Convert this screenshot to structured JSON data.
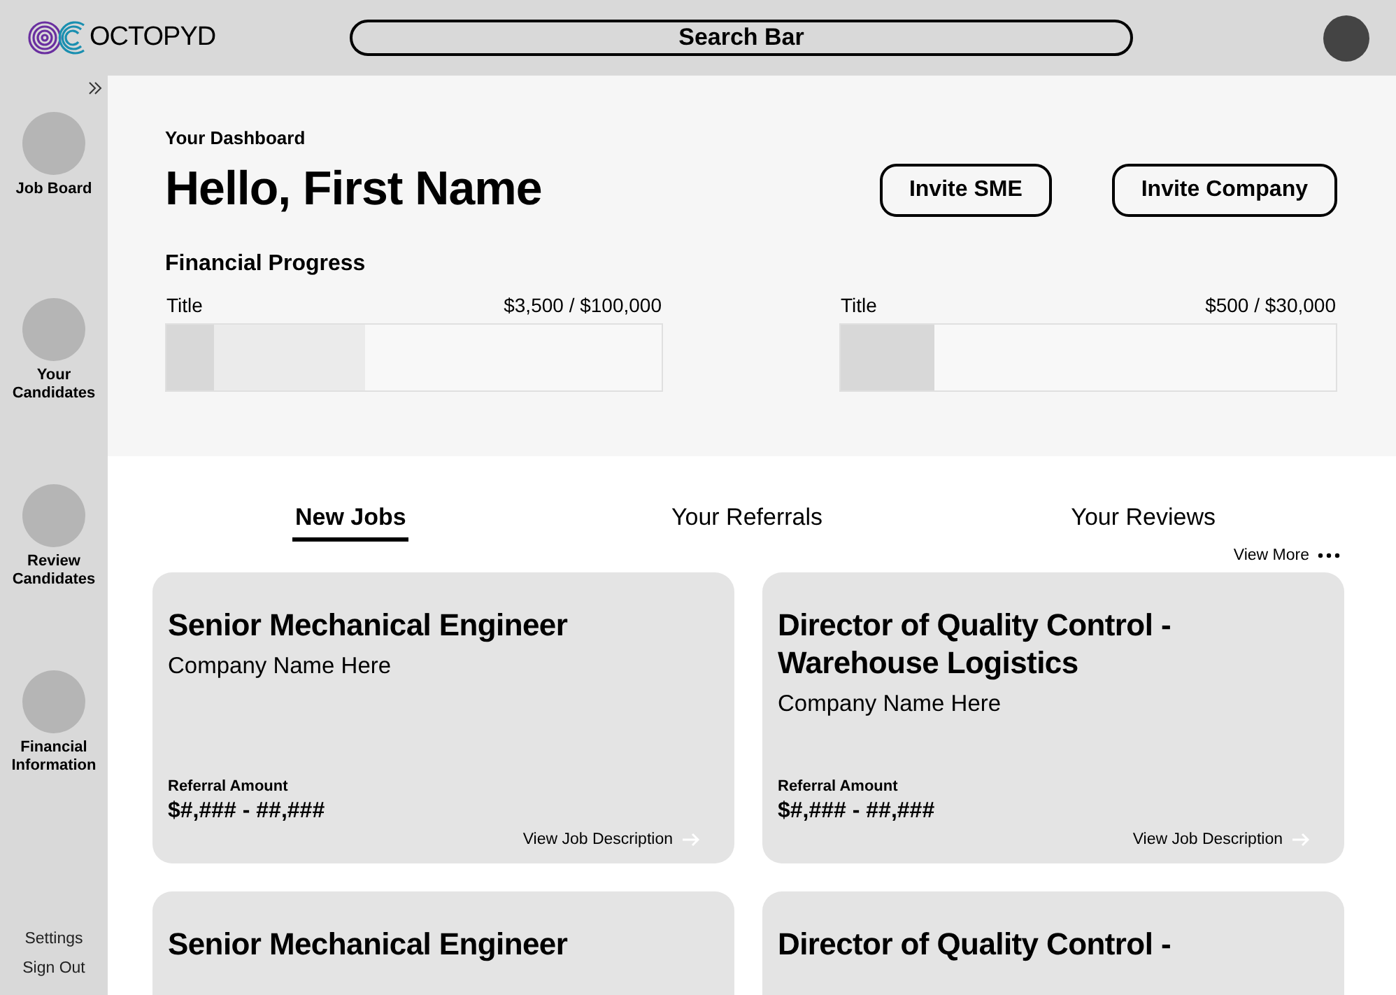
{
  "header": {
    "logo_text": "OCTOPYD",
    "search": {
      "placeholder": "Search Bar"
    }
  },
  "sidebar": {
    "items": [
      {
        "label": "Job Board"
      },
      {
        "label": "Your Candidates"
      },
      {
        "label": "Review Candidates"
      },
      {
        "label": "Financial Information"
      }
    ],
    "footer_links": [
      "Settings",
      "Sign Out"
    ]
  },
  "dashboard": {
    "eyebrow": "Your Dashboard",
    "greeting": "Hello, First Name",
    "buttons": [
      "Invite SME",
      "Invite Company"
    ],
    "financial_progress": {
      "title": "Financial Progress",
      "items": [
        {
          "title": "Title",
          "reading": "$3,500 / $100,000",
          "segments": [
            {
              "level": 0.095
            },
            {
              "level": 0.4
            }
          ]
        },
        {
          "title": "Title",
          "reading": "$500 / $30,000",
          "segments": [
            {
              "level": 0.19
            }
          ]
        }
      ]
    }
  },
  "tabs": [
    {
      "label": "New Jobs",
      "selected": true
    },
    {
      "label": "Your Referrals",
      "selected": false
    },
    {
      "label": "Your Reviews",
      "selected": false
    }
  ],
  "view_more": "View More",
  "jobs": [
    {
      "title": "Senior Mechanical Engineer",
      "company": "Company Name Here",
      "referral_label": "Referral Amount",
      "referral_amount": "$#,### - ##,###",
      "link": "View Job Description"
    },
    {
      "title": "Director of Quality Control - Warehouse Logistics",
      "company": "Company Name Here",
      "referral_label": "Referral Amount",
      "referral_amount": "$#,### - ##,###",
      "link": "View Job Description"
    },
    {
      "title": "Senior Mechanical Engineer"
    },
    {
      "title": "Director of Quality Control -"
    }
  ]
}
